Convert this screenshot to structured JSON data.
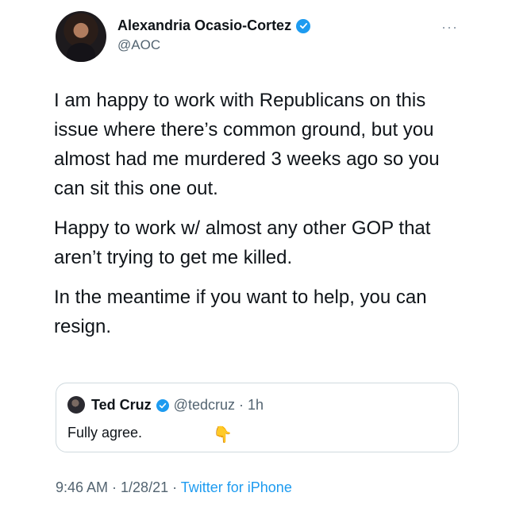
{
  "author": {
    "name": "Alexandria Ocasio-Cortez",
    "handle": "@AOC"
  },
  "menu": {
    "icon": "more-horizontal-icon",
    "glyph": "···"
  },
  "tweet": {
    "paragraphs": [
      "I am happy to work with Republicans on this issue where there’s common ground, but you almost had me murdered 3 weeks ago so you can sit this one out.",
      "Happy to work w/ almost any other GOP that aren’t trying to get me killed.",
      "In the meantime if you want to help, you can resign."
    ]
  },
  "quoted_tweet": {
    "name": "Ted Cruz",
    "handle_time": "@tedcruz · 1h",
    "text": "Fully agree.",
    "emoji": "👇",
    "emoji_icon": "pointing-down-emoji"
  },
  "footer": {
    "time_date": "9:46 AM · 1/28/21 · ",
    "source": "Twitter for iPhone"
  },
  "colors": {
    "verified": "#1d9bf0",
    "link": "#1d9bf0",
    "secondary_text": "#536471"
  }
}
